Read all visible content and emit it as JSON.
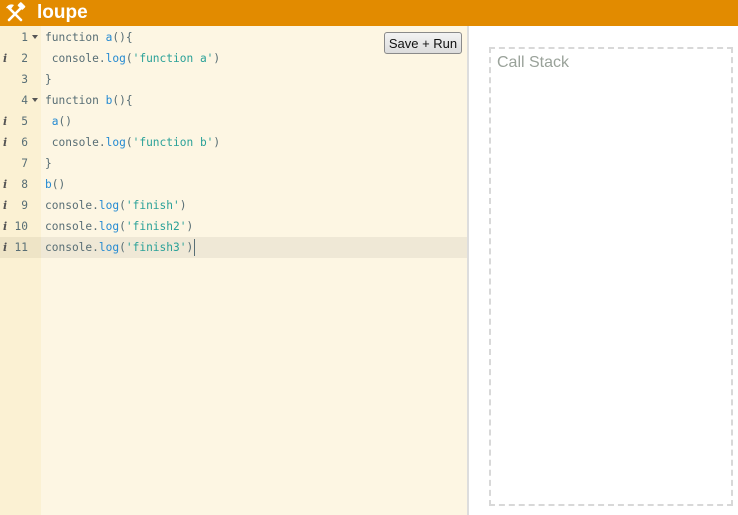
{
  "header": {
    "logo_icon": "hammer-and-pick-icon",
    "title": "loupe",
    "bg_color": "#e28b00"
  },
  "toolbar": {
    "save_run_label": "Save + Run"
  },
  "editor": {
    "active_line": 11,
    "lines": [
      {
        "num": "1",
        "fold": true,
        "info": false,
        "tokens": [
          [
            "p",
            "function "
          ],
          [
            "n",
            "a"
          ],
          [
            "p",
            "(){"
          ]
        ]
      },
      {
        "num": "2",
        "fold": false,
        "info": true,
        "tokens": [
          [
            "p",
            " console."
          ],
          [
            "n",
            "log"
          ],
          [
            "p",
            "("
          ],
          [
            "s",
            "'function a'"
          ],
          [
            "p",
            ")"
          ]
        ]
      },
      {
        "num": "3",
        "fold": false,
        "info": false,
        "tokens": [
          [
            "p",
            "}"
          ]
        ]
      },
      {
        "num": "4",
        "fold": true,
        "info": false,
        "tokens": [
          [
            "p",
            "function "
          ],
          [
            "n",
            "b"
          ],
          [
            "p",
            "(){"
          ]
        ]
      },
      {
        "num": "5",
        "fold": false,
        "info": true,
        "tokens": [
          [
            "p",
            " "
          ],
          [
            "n",
            "a"
          ],
          [
            "p",
            "()"
          ]
        ]
      },
      {
        "num": "6",
        "fold": false,
        "info": true,
        "tokens": [
          [
            "p",
            " console."
          ],
          [
            "n",
            "log"
          ],
          [
            "p",
            "("
          ],
          [
            "s",
            "'function b'"
          ],
          [
            "p",
            ")"
          ]
        ]
      },
      {
        "num": "7",
        "fold": false,
        "info": false,
        "tokens": [
          [
            "p",
            "}"
          ]
        ]
      },
      {
        "num": "8",
        "fold": false,
        "info": true,
        "tokens": [
          [
            "n",
            "b"
          ],
          [
            "p",
            "()"
          ]
        ]
      },
      {
        "num": "9",
        "fold": false,
        "info": true,
        "tokens": [
          [
            "p",
            "console."
          ],
          [
            "n",
            "log"
          ],
          [
            "p",
            "("
          ],
          [
            "s",
            "'finish'"
          ],
          [
            "p",
            ")"
          ]
        ]
      },
      {
        "num": "10",
        "fold": false,
        "info": true,
        "tokens": [
          [
            "p",
            "console."
          ],
          [
            "n",
            "log"
          ],
          [
            "p",
            "("
          ],
          [
            "s",
            "'finish2'"
          ],
          [
            "p",
            ")"
          ]
        ]
      },
      {
        "num": "11",
        "fold": false,
        "info": true,
        "tokens": [
          [
            "p",
            "console."
          ],
          [
            "n",
            "log"
          ],
          [
            "p",
            "("
          ],
          [
            "s",
            "'finish3'"
          ],
          [
            "p",
            ")"
          ]
        ]
      }
    ],
    "info_glyph": "i"
  },
  "call_stack": {
    "label": "Call Stack"
  }
}
